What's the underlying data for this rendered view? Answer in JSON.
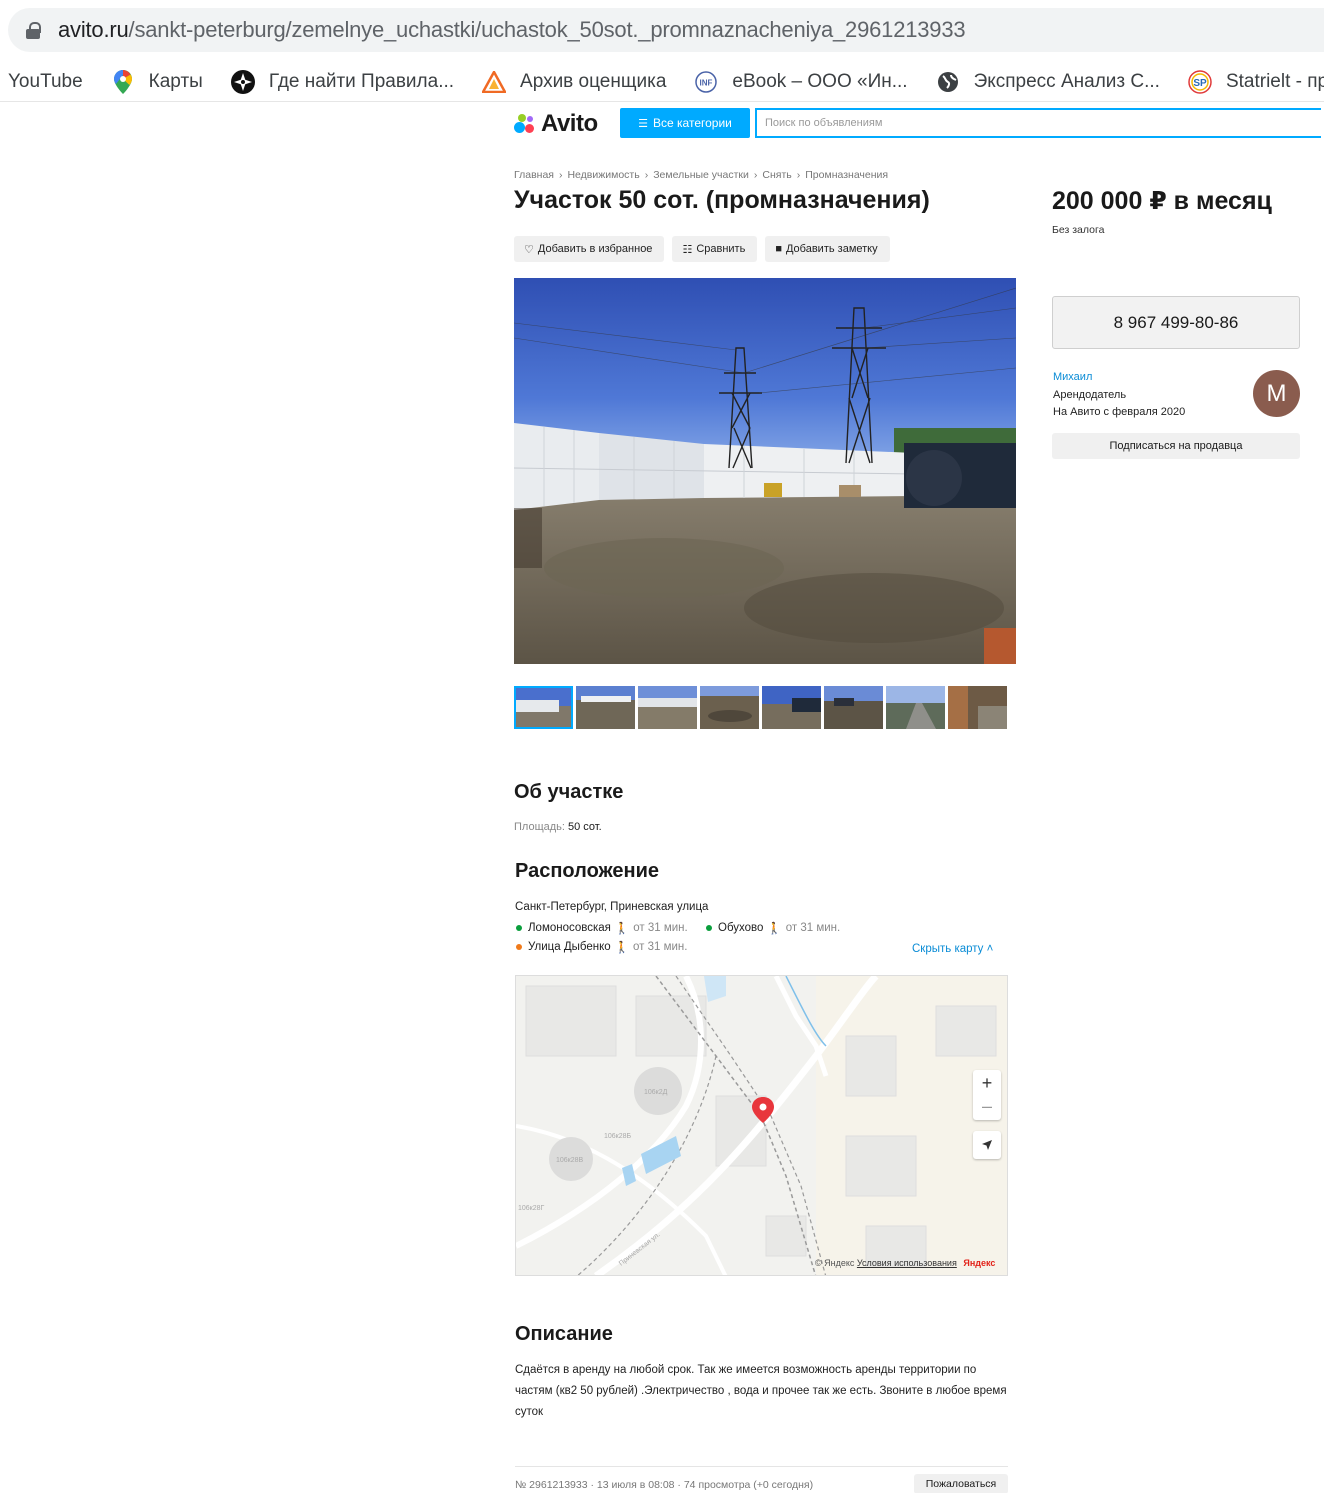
{
  "browser": {
    "url_host": "avito.ru",
    "url_path": "/sankt-peterburg/zemelnye_uchastki/uchastok_50sot._promnaznacheniya_2961213933",
    "bookmarks": [
      {
        "label": "YouTube",
        "icon": "youtube-icon"
      },
      {
        "label": "Карты",
        "icon": "maps-pin-icon"
      },
      {
        "label": "Где найти Правила...",
        "icon": "compass-icon"
      },
      {
        "label": "Архив оценщика",
        "icon": "triangle-icon"
      },
      {
        "label": "eBook – ООО «Ин...",
        "icon": "ebook-icon"
      },
      {
        "label": "Экспресс Анализ С...",
        "icon": "globe-icon"
      },
      {
        "label": "Statrielt - прода",
        "icon": "statrielt-icon"
      }
    ]
  },
  "header": {
    "logo": "Avito",
    "categories_label": "Все категории",
    "search_placeholder": "Поиск по объявлениям"
  },
  "listing": {
    "breadcrumbs": [
      "Главная",
      "Недвижимость",
      "Земельные участки",
      "Снять",
      "Промназначения"
    ],
    "title": "Участок 50 сот. (промназначения)",
    "price": "200 000 ₽ в месяц",
    "deposit": "Без залога",
    "actions": {
      "favorite": "Добавить в избранное",
      "compare": "Сравнить",
      "note": "Добавить заметку"
    },
    "thumbnail_count": 8
  },
  "seller": {
    "phone": "8 967 499-80-86",
    "name": "Михаил",
    "role": "Арендодатель",
    "since": "На Авито с февраля 2020",
    "avatar_letter": "М",
    "subscribe": "Подписаться на продавца"
  },
  "about": {
    "heading": "Об участке",
    "area_label": "Площадь:",
    "area_value": "50 сот."
  },
  "location": {
    "heading": "Расположение",
    "address": "Санкт-Петербург, Приневская улица",
    "metro": [
      {
        "name": "Ломоносовская",
        "distance": "от 31 мин.",
        "color": "#0a9e3c"
      },
      {
        "name": "Обухово",
        "distance": "от 31 мин.",
        "color": "#0a9e3c"
      },
      {
        "name": "Улица Дыбенко",
        "distance": "от 31 мин.",
        "color": "#f07a1a"
      }
    ],
    "hide_map": "Скрыть карту",
    "map_labels": [
      "106к2Д",
      "106к28Б",
      "106к28В",
      "106к28Г",
      "Приневская ул."
    ],
    "map_copyright": "© Яндекс",
    "map_terms": "Условия использования",
    "map_brand": "Яндекс"
  },
  "description": {
    "heading": "Описание",
    "text": "Сдаётся в аренду на любой срок. Так же имеется возможность аренды территории по частям (кв2 50 рублей) .Электричество , вода и прочее так же есть. Звоните в любое время суток"
  },
  "footer": {
    "meta": "№ 2961213933 · 13 июля в 08:08 · 74 просмотра (+0 сегодня)",
    "report": "Пожаловаться"
  },
  "colors": {
    "accent": "#00aaff",
    "link": "#0a8cd6",
    "avatar": "#8a5c4e",
    "map_pin": "#e8363c"
  }
}
